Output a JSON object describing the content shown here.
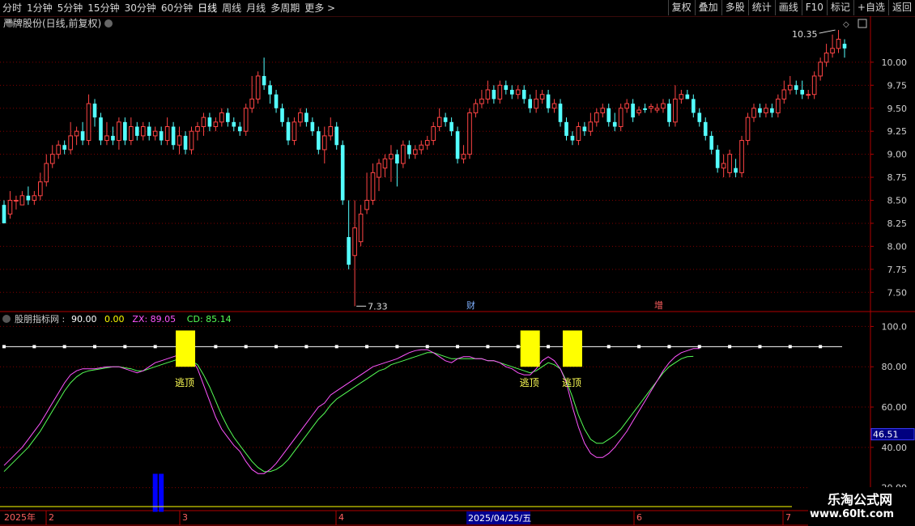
{
  "toolbar": {
    "left_items": [
      "分时",
      "1分钟",
      "5分钟",
      "15分钟",
      "30分钟",
      "60分钟",
      "日线",
      "周线",
      "月线",
      "多周期",
      "更多 >"
    ],
    "active_index": 6,
    "right_items": [
      "复权",
      "叠加",
      "多股",
      "统计",
      "画线",
      "F10",
      "标记",
      "+自选",
      "返回"
    ]
  },
  "main_chart": {
    "title": "严牌股份(日线,前复权)",
    "price_axis": [
      "10.00",
      "9.75",
      "9.50",
      "9.25",
      "9.00",
      "8.75",
      "8.50",
      "8.25",
      "8.00",
      "7.75",
      "7.50"
    ],
    "ylim": [
      7.3,
      10.5
    ],
    "high_label": "10.35",
    "low_label": "7.33",
    "event_labels": [
      "财",
      "增"
    ]
  },
  "indicator": {
    "name": "股朋指标网",
    "values": [
      {
        "label": "90.00",
        "color": "#ffffff"
      },
      {
        "label": "0.00",
        "color": "#ffff00"
      },
      {
        "label": "ZX: 89.05",
        "color": "#ff55ff"
      },
      {
        "label": "CD: 85.14",
        "color": "#55ff55"
      }
    ],
    "axis": [
      "100.0",
      "80.00",
      "60.00",
      "40.00",
      "20.00"
    ],
    "ylim": [
      9,
      107
    ],
    "current_value": "46.51",
    "signal_label": "逃顶"
  },
  "date_axis": {
    "year": "2025年",
    "months": [
      "2",
      "3",
      "4",
      "6",
      "7"
    ],
    "cursor_date": "2025/04/25/五"
  },
  "watermark": {
    "name": "乐淘公式网",
    "url": "www.60lt.com"
  },
  "colors": {
    "up": "#ff4444",
    "down": "#54ffff",
    "zx": "#ff55ff",
    "cd": "#55ff55",
    "grid": "#800000",
    "axis_border": "#b00000",
    "signal_box": "#ffff00",
    "bottom_bar": "#0000ff"
  },
  "chart_data": {
    "type": "candlestick",
    "candles": [
      [
        8.45,
        8.25,
        8.5,
        8.25
      ],
      [
        8.35,
        8.5,
        8.6,
        8.3
      ],
      [
        8.5,
        8.5,
        8.55,
        8.4
      ],
      [
        8.45,
        8.55,
        8.6,
        8.45
      ],
      [
        8.55,
        8.5,
        8.65,
        8.45
      ],
      [
        8.5,
        8.55,
        8.6,
        8.45
      ],
      [
        8.55,
        8.7,
        8.8,
        8.5
      ],
      [
        8.7,
        8.9,
        9.0,
        8.65
      ],
      [
        8.9,
        9.0,
        9.1,
        8.85
      ],
      [
        9.0,
        9.1,
        9.15,
        8.95
      ],
      [
        9.1,
        9.05,
        9.15,
        9.0
      ],
      [
        9.05,
        9.2,
        9.35,
        9.0
      ],
      [
        9.2,
        9.25,
        9.3,
        9.1
      ],
      [
        9.25,
        9.15,
        9.35,
        9.1
      ],
      [
        9.15,
        9.55,
        9.65,
        9.1
      ],
      [
        9.55,
        9.4,
        9.6,
        9.3
      ],
      [
        9.4,
        9.15,
        9.45,
        9.1
      ],
      [
        9.15,
        9.2,
        9.35,
        9.1
      ],
      [
        9.2,
        9.15,
        9.3,
        9.1
      ],
      [
        9.15,
        9.35,
        9.4,
        9.05
      ],
      [
        9.35,
        9.15,
        9.4,
        9.1
      ],
      [
        9.15,
        9.3,
        9.4,
        9.1
      ],
      [
        9.3,
        9.2,
        9.35,
        9.15
      ],
      [
        9.2,
        9.3,
        9.35,
        9.15
      ],
      [
        9.3,
        9.2,
        9.35,
        9.15
      ],
      [
        9.2,
        9.25,
        9.3,
        9.15
      ],
      [
        9.25,
        9.15,
        9.3,
        9.1
      ],
      [
        9.15,
        9.3,
        9.4,
        9.1
      ],
      [
        9.3,
        9.1,
        9.35,
        9.05
      ],
      [
        9.1,
        9.2,
        9.3,
        9.0
      ],
      [
        9.2,
        9.05,
        9.25,
        9.0
      ],
      [
        9.05,
        9.25,
        9.3,
        9.0
      ],
      [
        9.25,
        9.3,
        9.35,
        9.15
      ],
      [
        9.3,
        9.4,
        9.45,
        9.2
      ],
      [
        9.4,
        9.3,
        9.45,
        9.25
      ],
      [
        9.3,
        9.35,
        9.4,
        9.25
      ],
      [
        9.35,
        9.45,
        9.5,
        9.3
      ],
      [
        9.45,
        9.35,
        9.5,
        9.3
      ],
      [
        9.35,
        9.3,
        9.4,
        9.25
      ],
      [
        9.3,
        9.25,
        9.35,
        9.2
      ],
      [
        9.25,
        9.5,
        9.55,
        9.2
      ],
      [
        9.5,
        9.6,
        9.85,
        9.45
      ],
      [
        9.6,
        9.85,
        9.9,
        9.55
      ],
      [
        9.85,
        9.75,
        10.05,
        9.7
      ],
      [
        9.75,
        9.65,
        9.8,
        9.55
      ],
      [
        9.65,
        9.5,
        9.7,
        9.45
      ],
      [
        9.5,
        9.35,
        9.55,
        9.3
      ],
      [
        9.35,
        9.15,
        9.4,
        9.1
      ],
      [
        9.15,
        9.35,
        9.4,
        9.1
      ],
      [
        9.35,
        9.45,
        9.5,
        9.3
      ],
      [
        9.45,
        9.35,
        9.5,
        9.3
      ],
      [
        9.35,
        9.25,
        9.4,
        9.2
      ],
      [
        9.25,
        9.05,
        9.3,
        9.0
      ],
      [
        9.05,
        9.2,
        9.3,
        8.9
      ],
      [
        9.2,
        9.3,
        9.4,
        9.15
      ],
      [
        9.3,
        9.1,
        9.35,
        9.05
      ],
      [
        9.1,
        8.5,
        9.15,
        8.45
      ],
      [
        8.1,
        7.8,
        8.5,
        7.75
      ],
      [
        7.9,
        8.2,
        8.5,
        7.35
      ],
      [
        8.05,
        8.35,
        8.45,
        8.0
      ],
      [
        8.4,
        8.5,
        8.8,
        8.35
      ],
      [
        8.5,
        8.8,
        8.9,
        8.45
      ],
      [
        8.75,
        8.9,
        8.95,
        8.6
      ],
      [
        8.85,
        8.95,
        9.0,
        8.75
      ],
      [
        8.95,
        9.0,
        9.1,
        8.7
      ],
      [
        9.0,
        8.9,
        9.05,
        8.65
      ],
      [
        8.9,
        9.1,
        9.15,
        8.85
      ],
      [
        9.1,
        9.0,
        9.15,
        8.95
      ],
      [
        9.0,
        9.05,
        9.1,
        8.95
      ],
      [
        9.05,
        9.1,
        9.15,
        9.0
      ],
      [
        9.1,
        9.15,
        9.2,
        9.05
      ],
      [
        9.15,
        9.3,
        9.35,
        9.1
      ],
      [
        9.3,
        9.4,
        9.5,
        9.25
      ],
      [
        9.4,
        9.35,
        9.45,
        9.3
      ],
      [
        9.35,
        9.25,
        9.4,
        9.2
      ],
      [
        9.25,
        8.95,
        9.3,
        8.9
      ],
      [
        8.95,
        9.0,
        9.1,
        8.9
      ],
      [
        9.0,
        9.45,
        9.5,
        8.95
      ],
      [
        9.45,
        9.55,
        9.6,
        9.4
      ],
      [
        9.55,
        9.6,
        9.7,
        9.5
      ],
      [
        9.6,
        9.7,
        9.8,
        9.55
      ],
      [
        9.7,
        9.6,
        9.75,
        9.55
      ],
      [
        9.6,
        9.75,
        9.8,
        9.55
      ],
      [
        9.75,
        9.7,
        9.8,
        9.65
      ],
      [
        9.7,
        9.65,
        9.75,
        9.6
      ],
      [
        9.65,
        9.7,
        9.75,
        9.6
      ],
      [
        9.7,
        9.6,
        9.75,
        9.55
      ],
      [
        9.6,
        9.5,
        9.65,
        9.45
      ],
      [
        9.5,
        9.6,
        9.7,
        9.45
      ],
      [
        9.6,
        9.65,
        9.7,
        9.55
      ],
      [
        9.65,
        9.5,
        9.7,
        9.45
      ],
      [
        9.5,
        9.55,
        9.6,
        9.45
      ],
      [
        9.55,
        9.35,
        9.6,
        9.3
      ],
      [
        9.35,
        9.2,
        9.4,
        9.15
      ],
      [
        9.2,
        9.15,
        9.25,
        9.1
      ],
      [
        9.15,
        9.3,
        9.35,
        9.1
      ],
      [
        9.3,
        9.25,
        9.35,
        9.2
      ],
      [
        9.25,
        9.35,
        9.45,
        9.2
      ],
      [
        9.35,
        9.45,
        9.5,
        9.3
      ],
      [
        9.45,
        9.5,
        9.55,
        9.4
      ],
      [
        9.5,
        9.35,
        9.55,
        9.3
      ],
      [
        9.35,
        9.3,
        9.45,
        9.25
      ],
      [
        9.3,
        9.5,
        9.55,
        9.25
      ],
      [
        9.5,
        9.55,
        9.6,
        9.45
      ],
      [
        9.55,
        9.4,
        9.6,
        9.35
      ],
      [
        9.45,
        9.48,
        9.52,
        9.42
      ],
      [
        9.5,
        9.48,
        9.55,
        9.45
      ],
      [
        9.5,
        9.52,
        9.55,
        9.45
      ],
      [
        9.48,
        9.5,
        9.55,
        9.45
      ],
      [
        9.5,
        9.55,
        9.6,
        9.45
      ],
      [
        9.55,
        9.35,
        9.6,
        9.3
      ],
      [
        9.35,
        9.6,
        9.75,
        9.3
      ],
      [
        9.6,
        9.65,
        9.7,
        9.55
      ],
      [
        9.65,
        9.6,
        9.7,
        9.6
      ],
      [
        9.6,
        9.45,
        9.65,
        9.4
      ],
      [
        9.45,
        9.35,
        9.5,
        9.3
      ],
      [
        9.35,
        9.2,
        9.4,
        9.15
      ],
      [
        9.2,
        9.05,
        9.25,
        9.0
      ],
      [
        9.05,
        8.85,
        9.1,
        8.8
      ],
      [
        8.85,
        8.9,
        9.0,
        8.75
      ],
      [
        8.8,
        9.0,
        9.05,
        8.75
      ],
      [
        8.85,
        8.8,
        8.95,
        8.75
      ],
      [
        8.8,
        9.15,
        9.2,
        8.75
      ],
      [
        9.15,
        9.4,
        9.45,
        9.1
      ],
      [
        9.4,
        9.5,
        9.55,
        9.35
      ],
      [
        9.5,
        9.45,
        9.55,
        9.4
      ],
      [
        9.45,
        9.5,
        9.55,
        9.4
      ],
      [
        9.5,
        9.45,
        9.55,
        9.4
      ],
      [
        9.45,
        9.6,
        9.65,
        9.4
      ],
      [
        9.6,
        9.7,
        9.8,
        9.55
      ],
      [
        9.7,
        9.75,
        9.85,
        9.65
      ],
      [
        9.75,
        9.7,
        9.8,
        9.65
      ],
      [
        9.7,
        9.65,
        9.8,
        9.6
      ],
      [
        9.65,
        9.65,
        9.7,
        9.6
      ],
      [
        9.65,
        9.85,
        9.9,
        9.6
      ],
      [
        9.85,
        10.0,
        10.05,
        9.8
      ],
      [
        10.0,
        10.1,
        10.2,
        9.95
      ],
      [
        10.1,
        10.15,
        10.3,
        10.05
      ],
      [
        10.15,
        10.25,
        10.35,
        10.1
      ],
      [
        10.2,
        10.15,
        10.25,
        10.05
      ]
    ],
    "zx": [
      31,
      34,
      37,
      40,
      44,
      48,
      52,
      57,
      62,
      67,
      72,
      76,
      78,
      79,
      79,
      79,
      79.5,
      80,
      80,
      80,
      79,
      78,
      77,
      78,
      80,
      82,
      83,
      84,
      85,
      86,
      85,
      84,
      79,
      71,
      63,
      55,
      49,
      45,
      41,
      38,
      33,
      29,
      27,
      27,
      29,
      32,
      36,
      40,
      44,
      48,
      52,
      56,
      60,
      62,
      66,
      68,
      70,
      72,
      74,
      76,
      78,
      80,
      81,
      82,
      83,
      84,
      85.5,
      87,
      88,
      88.5,
      88.5,
      87,
      85,
      83,
      82,
      84,
      85,
      85,
      84,
      84,
      83,
      83,
      82,
      80,
      79,
      77,
      76,
      76,
      79,
      83,
      85,
      83,
      79,
      72,
      60,
      50,
      42,
      37,
      35,
      35,
      37,
      40,
      44,
      48,
      53,
      58,
      63,
      68,
      73,
      78,
      82,
      85,
      87,
      88,
      89,
      89.05
    ],
    "cd": [
      28,
      31,
      34,
      37,
      40,
      44,
      48,
      53,
      58,
      63,
      68,
      72,
      75,
      77,
      78,
      78.5,
      79,
      79.5,
      80,
      80,
      79.5,
      79,
      78,
      78,
      79,
      80,
      81,
      82,
      83,
      84,
      84,
      83,
      81,
      76,
      70,
      63,
      56,
      50,
      45,
      41,
      37,
      33,
      30,
      28,
      28,
      29,
      31,
      34,
      38,
      42,
      46,
      50,
      54,
      57,
      61,
      64,
      66,
      68,
      70,
      72,
      74,
      76,
      78,
      79,
      81,
      82,
      83,
      84,
      85,
      86,
      87,
      87,
      86,
      85,
      84,
      84,
      84,
      84,
      84,
      84,
      83,
      83,
      82,
      81,
      80,
      79,
      78,
      77,
      78,
      80,
      82,
      81,
      79,
      73,
      65,
      56,
      49,
      44,
      42,
      42,
      44,
      46,
      49,
      53,
      57,
      61,
      65,
      69,
      73,
      77,
      80,
      82,
      84,
      85,
      85.14
    ],
    "signals": [
      {
        "index": 30
      },
      {
        "index": 87
      },
      {
        "index": 94
      }
    ],
    "reference_line": 90,
    "bottom_bars": [
      25,
      26
    ]
  }
}
